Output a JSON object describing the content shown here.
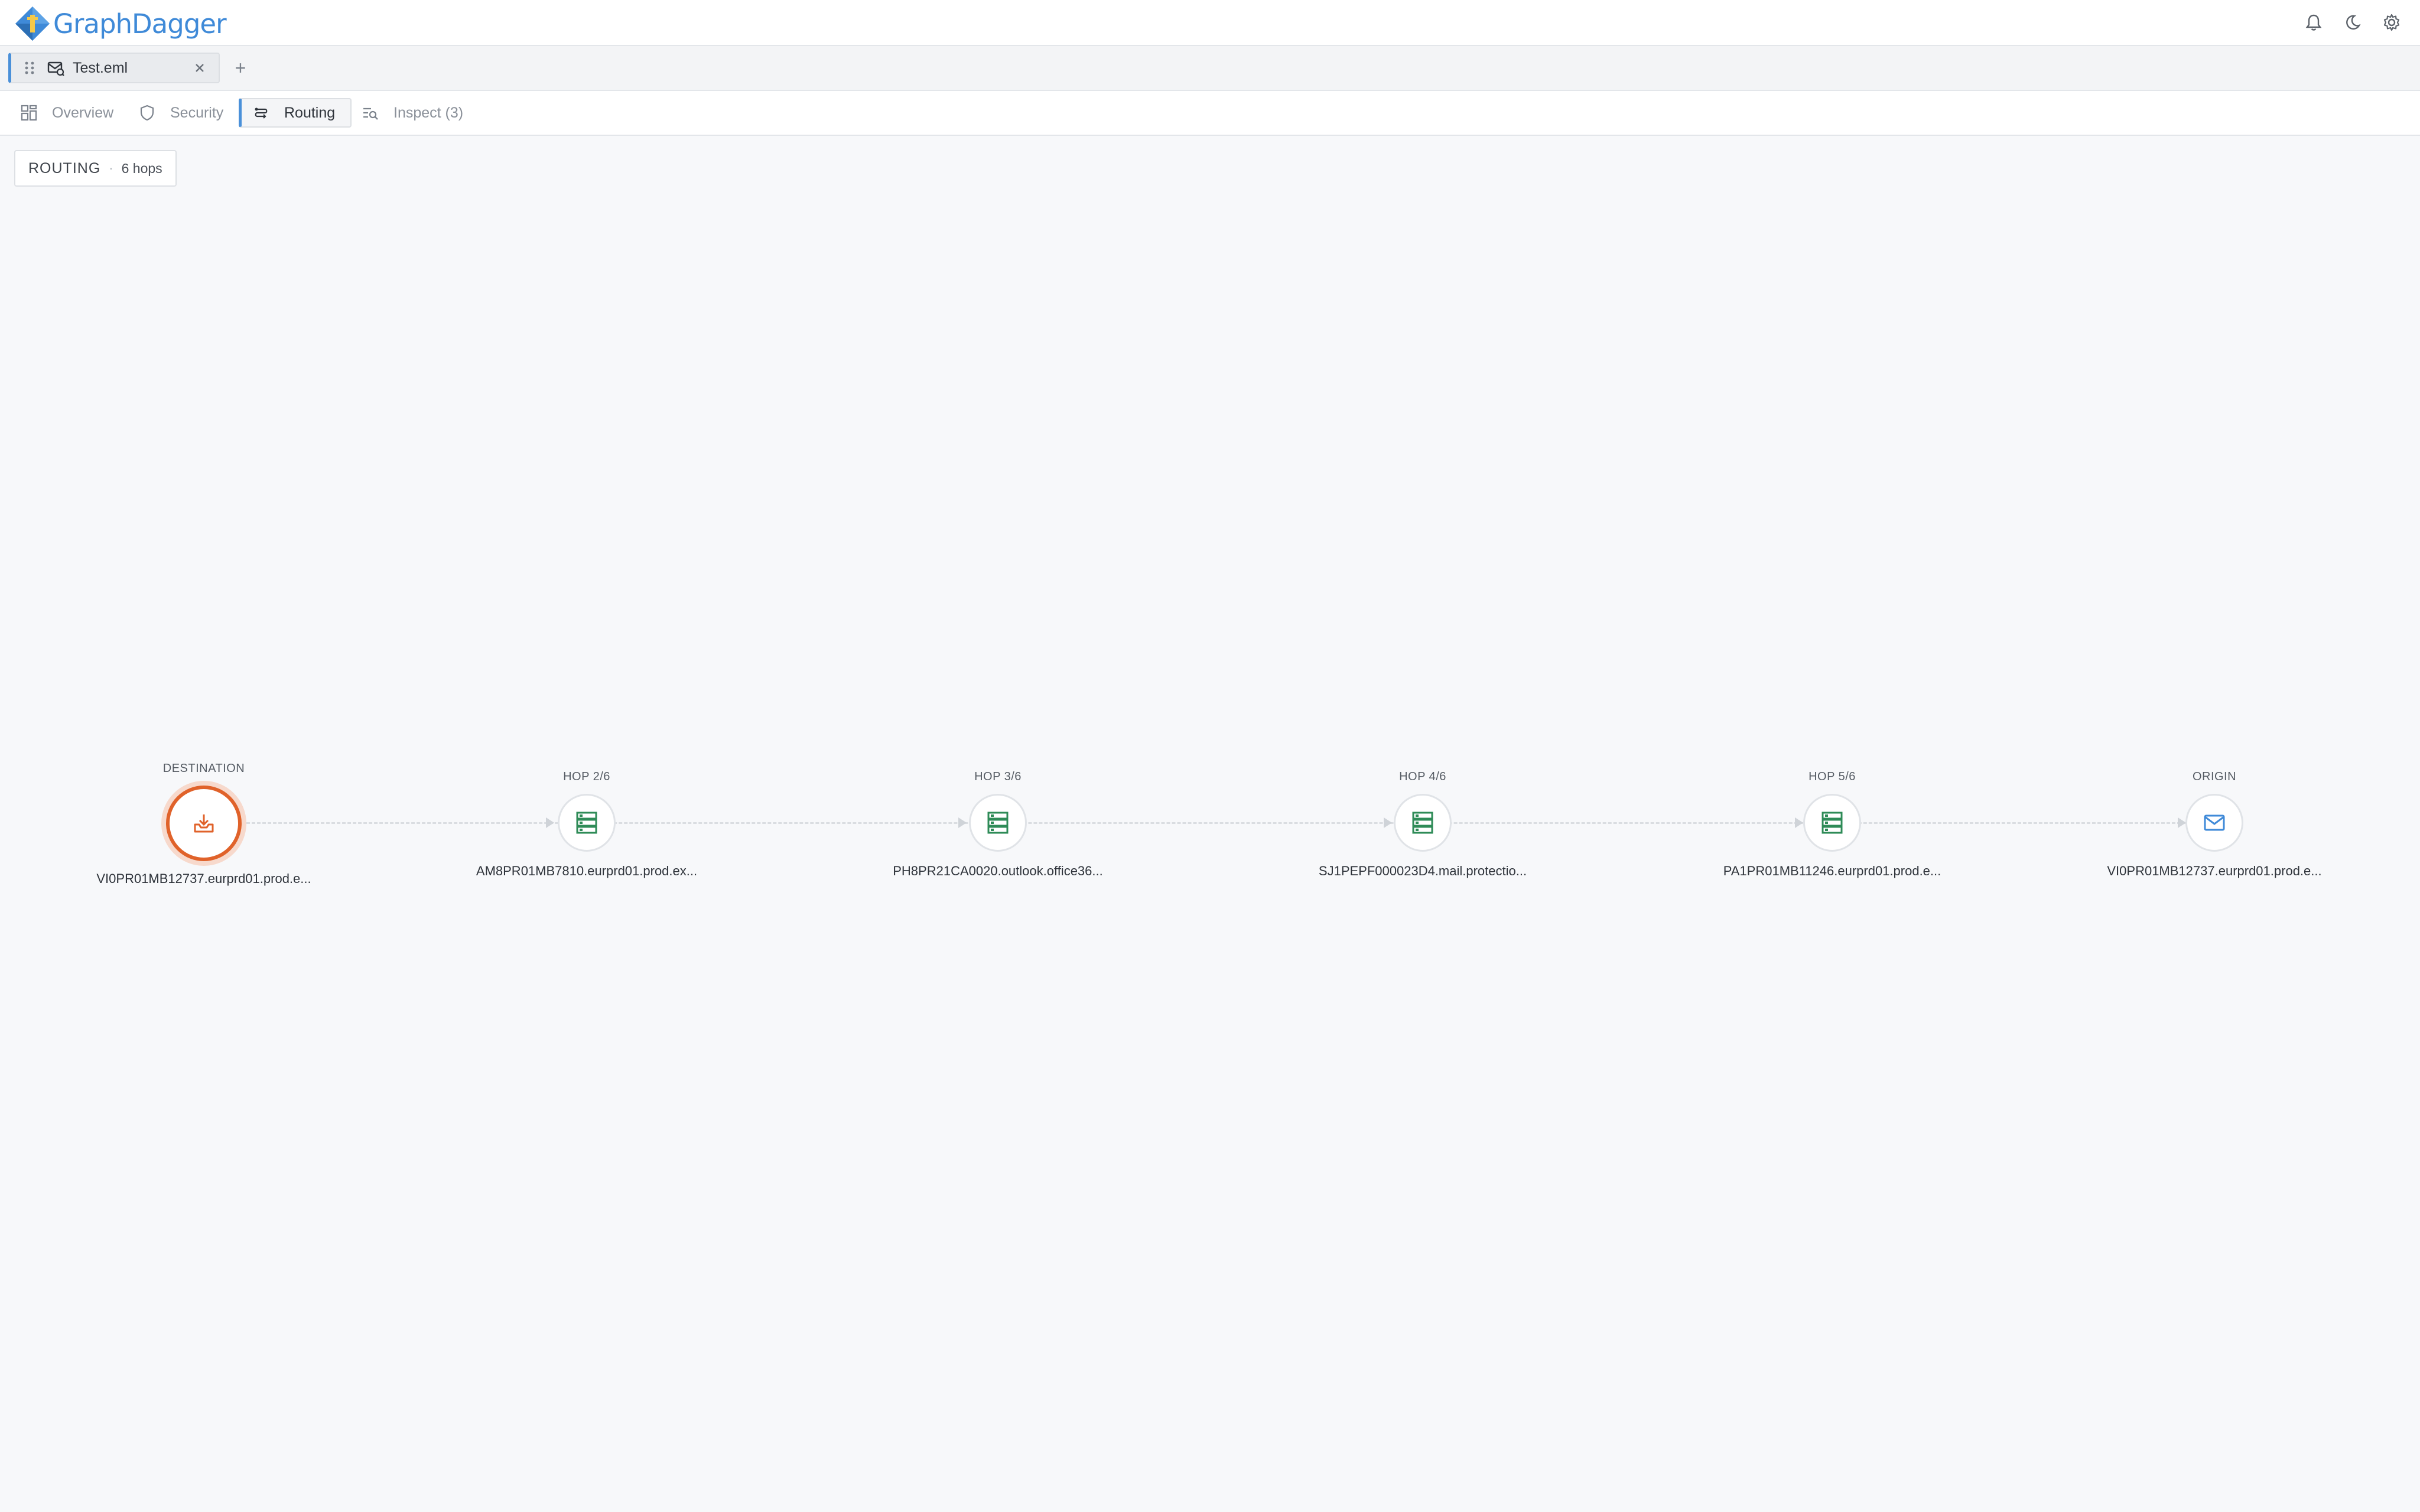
{
  "app": {
    "name": "GraphDagger",
    "icons": [
      "bell-icon",
      "moon-icon",
      "gear-icon"
    ]
  },
  "file_tabs": [
    {
      "name": "Test.eml",
      "icon": "mail-icon",
      "active": true
    }
  ],
  "new_tab_label": "+",
  "view_tabs": [
    {
      "label": "Overview",
      "icon": "dashboard-icon",
      "active": false
    },
    {
      "label": "Security",
      "icon": "shield-icon",
      "active": false
    },
    {
      "label": "Routing",
      "icon": "route-icon",
      "active": true
    },
    {
      "label": "Inspect (3)",
      "icon": "inspect-icon",
      "active": false
    }
  ],
  "routing": {
    "title": "ROUTING",
    "separator": "·",
    "count_label": "6 hops",
    "nodes": [
      {
        "caption": "DESTINATION",
        "host": "VI0PR01MB12737.eurprd01.prod.e...",
        "icon": "inbox-download-icon",
        "kind": "destination"
      },
      {
        "caption": "HOP 2/6",
        "host": "AM8PR01MB7810.eurprd01.prod.ex...",
        "icon": "server-icon",
        "kind": "hop"
      },
      {
        "caption": "HOP 3/6",
        "host": "PH8PR21CA0020.outlook.office36...",
        "icon": "server-icon",
        "kind": "hop"
      },
      {
        "caption": "HOP 4/6",
        "host": "SJ1PEPF000023D4.mail.protectio...",
        "icon": "server-icon",
        "kind": "hop"
      },
      {
        "caption": "HOP 5/6",
        "host": "PA1PR01MB11246.eurprd01.prod.e...",
        "icon": "server-icon",
        "kind": "hop"
      },
      {
        "caption": "ORIGIN",
        "host": "VI0PR01MB12737.eurprd01.prod.e...",
        "icon": "envelope-icon",
        "kind": "origin"
      }
    ]
  },
  "colors": {
    "accent": "#4a90d9",
    "destination": "#e0622a",
    "hop": "#2e8b57",
    "origin": "#3f8ad8"
  }
}
